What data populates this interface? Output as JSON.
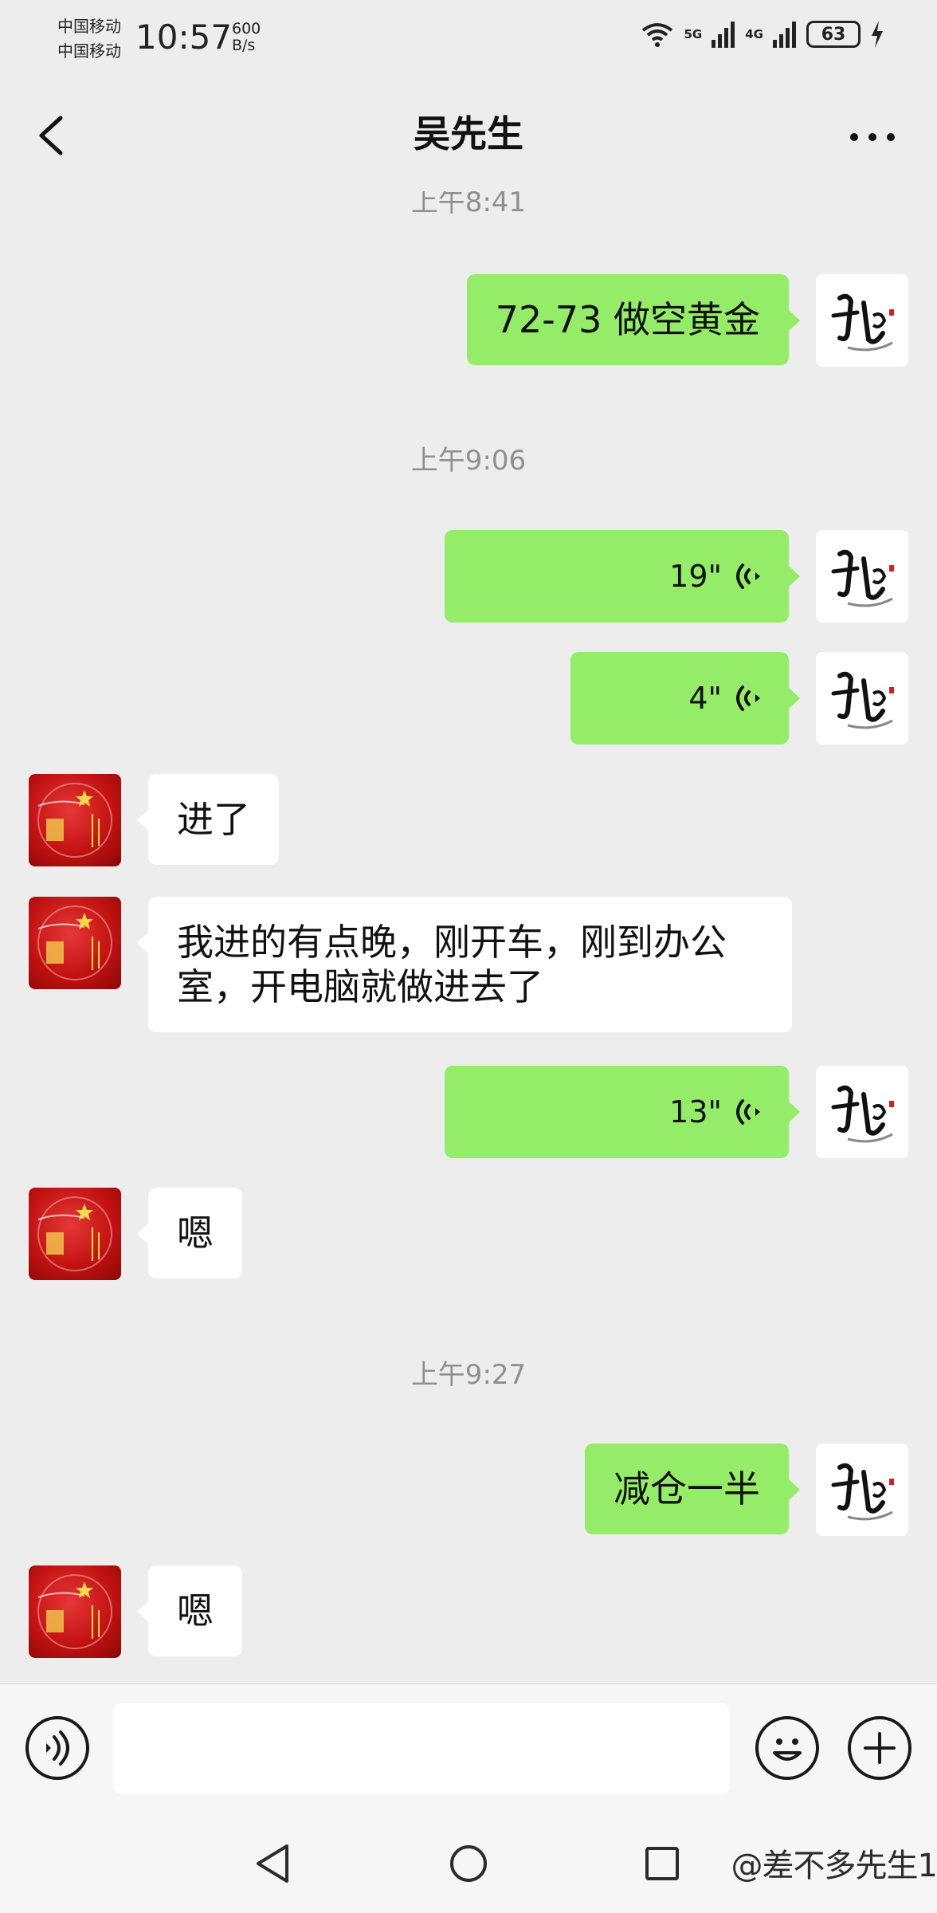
{
  "status_bar": {
    "carrier_1": "中国移动",
    "carrier_2": "中国移动",
    "time": "10:57",
    "net_speed_value": "600",
    "net_speed_unit": "B/s",
    "signal_1_label": "5G",
    "signal_2_label": "4G",
    "battery": "63"
  },
  "header": {
    "title": "吴先生",
    "back_icon": "chevron-left-icon",
    "more_icon": "ellipsis-icon"
  },
  "messages": {
    "ts_1": "上午8:41",
    "msg_1": "72-73 做空黄金",
    "ts_2": "上午9:06",
    "voice_1": "19\"",
    "voice_2": "4\"",
    "msg_4": "进了",
    "msg_5": "我进的有点晚，刚开车，刚到办公室，开电脑就做进去了",
    "voice_3": "13\"",
    "msg_7": "嗯",
    "ts_3": "上午9:27",
    "msg_8": "减仓一半",
    "msg_9": "嗯"
  },
  "input_bar": {
    "voice_toggle_icon": "voice-mode-icon",
    "text_value": "",
    "emoji_icon": "emoji-icon",
    "plus_icon": "plus-icon"
  },
  "system_nav": {
    "back": "triangle-back-icon",
    "home": "circle-home-icon",
    "recents": "square-recents-icon",
    "watermark": "@差不多先生1"
  },
  "colors": {
    "background": "#ededed",
    "my_bubble": "#95ec69",
    "peer_bubble": "#ffffff",
    "timestamp": "#8f8f8f"
  }
}
